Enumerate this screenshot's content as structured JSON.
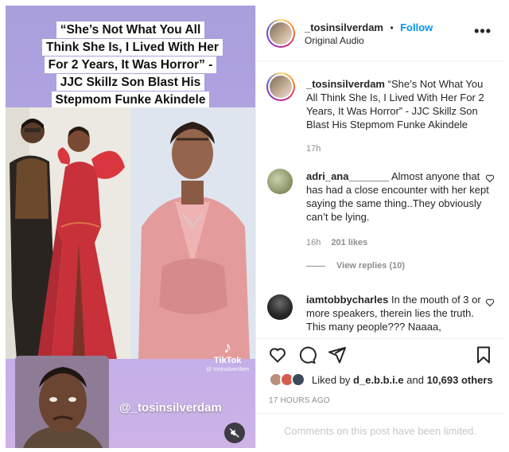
{
  "media": {
    "headline": "“She’s Not What You All Think She Is, I Lived With Her For 2 Years, It Was Horror” - JJC Skillz Son Blast His Stepmom Funke Akindele",
    "tiktok_label": "TikTok",
    "tiktok_handle": "@ tosinsilverdam",
    "overlay_handle": "@_tosinsilverdam",
    "mute_icon": "speaker-muted-icon"
  },
  "header": {
    "username": "_tosinsilverdam",
    "separator": "•",
    "follow_label": "Follow",
    "audio_label": "Original Audio",
    "more_icon": "more-horizontal-icon"
  },
  "caption": {
    "username": "_tosinsilverdam",
    "text": "“She’s Not What You All Think She Is, I Lived With Her For 2 Years, It Was Horror” - JJC Skillz Son Blast His Stepmom Funke Akindele",
    "time": "17h"
  },
  "comments": [
    {
      "username": "adri_ana_______",
      "text": "Almost anyone that has had a close encounter with her kept saying the same thing..They obviously can’t be lying.",
      "time": "16h",
      "likes": "201 likes",
      "view_replies": "View replies (10)"
    },
    {
      "username": "iamtobbycharles",
      "text": "In the mouth of 3 or more speakers, therein lies the truth. This many people??? Naaaa,"
    }
  ],
  "actions": {
    "like_icon": "heart-icon",
    "comment_icon": "comment-icon",
    "share_icon": "share-icon",
    "save_icon": "bookmark-icon"
  },
  "likes": {
    "prefix": "Liked by",
    "user": "d_e.b.b.i.e",
    "joiner": "and",
    "others": "10,693 others"
  },
  "timestamp": "17 HOURS AGO",
  "comments_limited": "Comments on this post have been limited.",
  "colors": {
    "follow_blue": "#0095f6",
    "muted_text": "#8e8e8e",
    "media_background": "#b3a6e4"
  }
}
